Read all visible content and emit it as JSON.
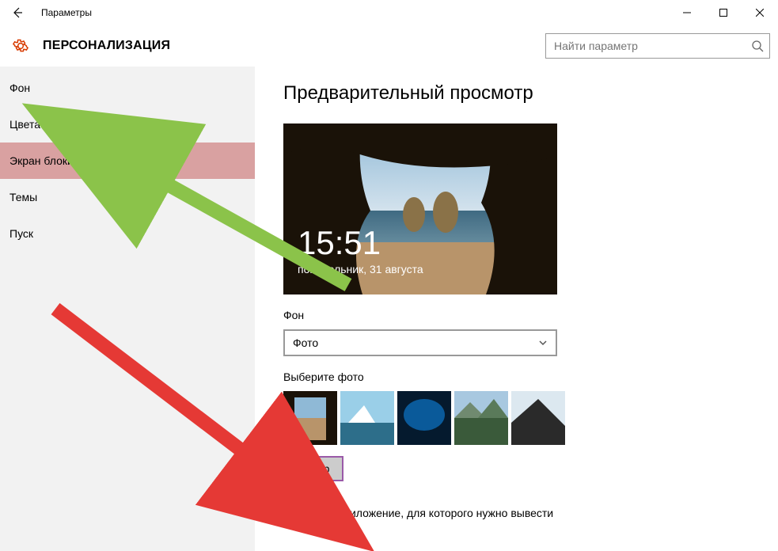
{
  "titlebar": {
    "title": "Параметры"
  },
  "header": {
    "category": "ПЕРСОНАЛИЗАЦИЯ",
    "search_placeholder": "Найти параметр"
  },
  "sidebar": {
    "items": [
      {
        "label": "Фон"
      },
      {
        "label": "Цвета"
      },
      {
        "label": "Экран блокировки"
      },
      {
        "label": "Темы"
      },
      {
        "label": "Пуск"
      }
    ]
  },
  "main": {
    "preview_heading": "Предварительный просмотр",
    "preview": {
      "time": "15:51",
      "date": "понедельник, 31 августа"
    },
    "background_label": "Фон",
    "background_value": "Фото",
    "choose_photo_label": "Выберите фото",
    "browse_label": "Обзор",
    "app_choose_text": "Выберите приложение, для которого нужно вывести"
  }
}
